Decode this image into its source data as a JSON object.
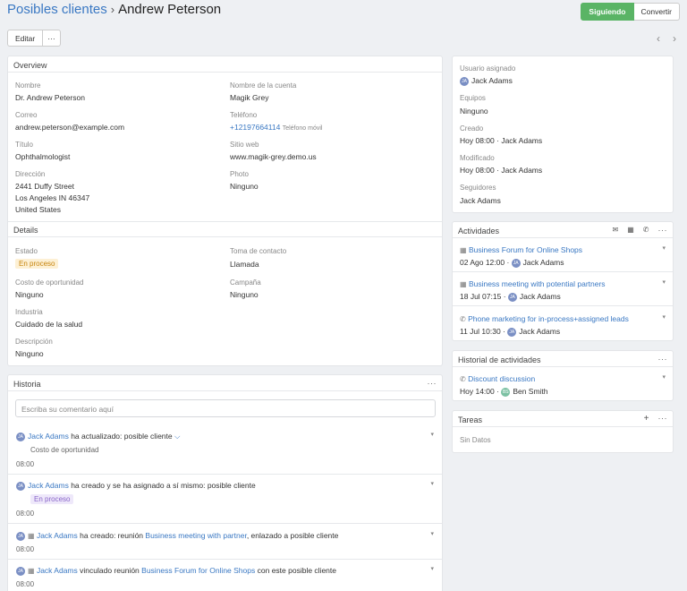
{
  "header": {
    "crumb": "Posibles clientes",
    "separator": "›",
    "title": "Andrew Peterson"
  },
  "actions": {
    "follow": "Siguiendo",
    "convert": "Convertir",
    "edit": "Editar",
    "more": "···",
    "prev": "‹",
    "next": "›"
  },
  "overview": {
    "title": "Overview",
    "name_label": "Nombre",
    "name": "Dr. Andrew Peterson",
    "account_label": "Nombre de la cuenta",
    "account": "Magik Grey",
    "email_label": "Correo",
    "email": "andrew.peterson@example.com",
    "phone_label": "Teléfono",
    "phone": "+12197664114",
    "phone_type": "Teléfono móvil",
    "title_label": "Título",
    "title_value": "Ophthalmologist",
    "website_label": "Sitio web",
    "website": "www.magik-grey.demo.us",
    "address_label": "Dirección",
    "address1": "2441 Duffy Street",
    "address2": "Los Angeles IN 46347",
    "address3": "United States",
    "photo_label": "Photo",
    "photo": "Ninguno"
  },
  "details": {
    "title": "Details",
    "status_label": "Estado",
    "status": "En proceso",
    "contact_label": "Toma de contacto",
    "contact": "Llamada",
    "cost_label": "Costo de oportunidad",
    "cost": "Ninguno",
    "campaign_label": "Campaña",
    "campaign": "Ninguno",
    "industry_label": "Industria",
    "industry": "Cuidado de la salud",
    "desc_label": "Descripción",
    "desc": "Ninguno"
  },
  "history": {
    "title": "Historia",
    "placeholder": "Escriba su comentario aquí",
    "items": [
      {
        "user": "Jack Adams",
        "text": "ha actualizado: posible cliente",
        "sub": "Costo de oportunidad",
        "time": "08:00"
      },
      {
        "user": "Jack Adams",
        "text": "ha creado y se ha asignado a sí mismo: posible cliente",
        "badge": "En proceso",
        "time": "08:00"
      },
      {
        "user": "Jack Adams",
        "text": "ha creado: reunión",
        "link": "Business meeting with partner",
        "tail": ", enlazado a posible cliente",
        "time": "08:00"
      },
      {
        "user": "Jack Adams",
        "text": "vinculado reunión",
        "link": "Business Forum for Online Shops",
        "tail": "con este posible cliente",
        "time": "08:00"
      }
    ]
  },
  "side": {
    "assigned_label": "Usuario asignado",
    "assigned": "Jack Adams",
    "teams_label": "Equipos",
    "teams": "Ninguno",
    "created_label": "Creado",
    "created_time": "Hoy 08:00",
    "created_by": "Jack Adams",
    "modified_label": "Modificado",
    "modified_time": "Hoy 08:00",
    "modified_by": "Jack Adams",
    "followers_label": "Seguidores",
    "followers": "Jack Adams"
  },
  "activities": {
    "title": "Actividades",
    "items": [
      {
        "name": "Business Forum for Online Shops",
        "date": "02 Ago 12:00",
        "user": "Jack Adams"
      },
      {
        "name": "Business meeting with potential partners",
        "date": "18 Jul 07:15",
        "user": "Jack Adams"
      },
      {
        "name": "Phone marketing for in-process+assigned leads",
        "date": "11 Jul 10:30",
        "user": "Jack Adams"
      }
    ]
  },
  "activity_history": {
    "title": "Historial de actividades",
    "item": {
      "name": "Discount discussion",
      "date": "Hoy 14:00",
      "user": "Ben Smith"
    }
  },
  "tasks": {
    "title": "Tareas",
    "empty": "Sin Datos",
    "add": "+"
  },
  "avatars": {
    "ja": "JA",
    "bs": "BS"
  }
}
